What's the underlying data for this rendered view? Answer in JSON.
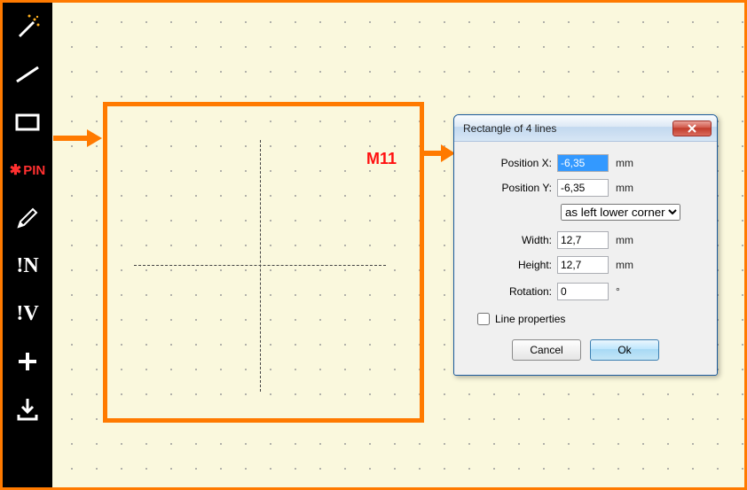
{
  "toolbar": {
    "pin_label": "PIN",
    "in_label": "!N",
    "iv_label": "!V"
  },
  "annotation": {
    "label": "M11"
  },
  "dialog": {
    "title": "Rectangle of 4 lines",
    "position_x_label": "Position X:",
    "position_x_value": "-6,35",
    "position_y_label": "Position Y:",
    "position_y_value": "-6,35",
    "unit": "mm",
    "anchor_label": "as left lower corner",
    "width_label": "Width:",
    "width_value": "12,7",
    "height_label": "Height:",
    "height_value": "12,7",
    "rotation_label": "Rotation:",
    "rotation_value": "0",
    "rotation_unit": "°",
    "line_props_label": "Line properties",
    "cancel_label": "Cancel",
    "ok_label": "Ok"
  }
}
